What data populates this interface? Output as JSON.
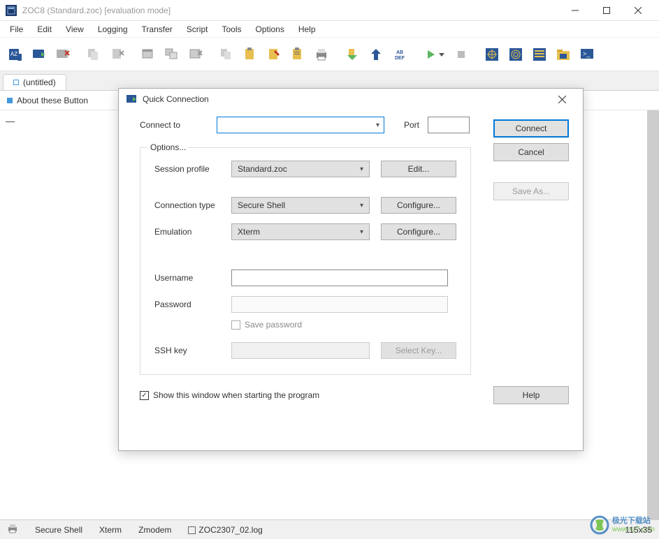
{
  "window": {
    "title": "ZOC8 (Standard.zoc) [evaluation mode]"
  },
  "menu": {
    "items": [
      "File",
      "Edit",
      "View",
      "Logging",
      "Transfer",
      "Script",
      "Tools",
      "Options",
      "Help"
    ]
  },
  "tab": {
    "label": "(untitled)"
  },
  "secondary_bar": {
    "label": "About these Button"
  },
  "terminal": {
    "prompt": "—"
  },
  "statusbar": {
    "conn_type": "Secure Shell",
    "emulation": "Xterm",
    "transfer": "Zmodem",
    "logfile": "ZOC2307_02.log",
    "size": "115x35"
  },
  "dialog": {
    "title": "Quick Connection",
    "connect_to_label": "Connect to",
    "connect_to_value": "",
    "port_label": "Port",
    "port_value": "",
    "options_legend": "Options...",
    "session_profile_label": "Session profile",
    "session_profile_value": "Standard.zoc",
    "edit_btn": "Edit...",
    "connection_type_label": "Connection type",
    "connection_type_value": "Secure Shell",
    "configure_btn": "Configure...",
    "emulation_label": "Emulation",
    "emulation_value": "Xterm",
    "username_label": "Username",
    "username_value": "",
    "password_label": "Password",
    "password_value": "",
    "save_password_label": "Save password",
    "sshkey_label": "SSH key",
    "sshkey_value": "",
    "select_key_btn": "Select Key...",
    "show_window_label": "Show this window when starting the program",
    "connect_btn": "Connect",
    "cancel_btn": "Cancel",
    "saveas_btn": "Save As...",
    "help_btn": "Help"
  },
  "watermark": {
    "line1": "极光下载站",
    "line2": "www.xz7.com"
  }
}
